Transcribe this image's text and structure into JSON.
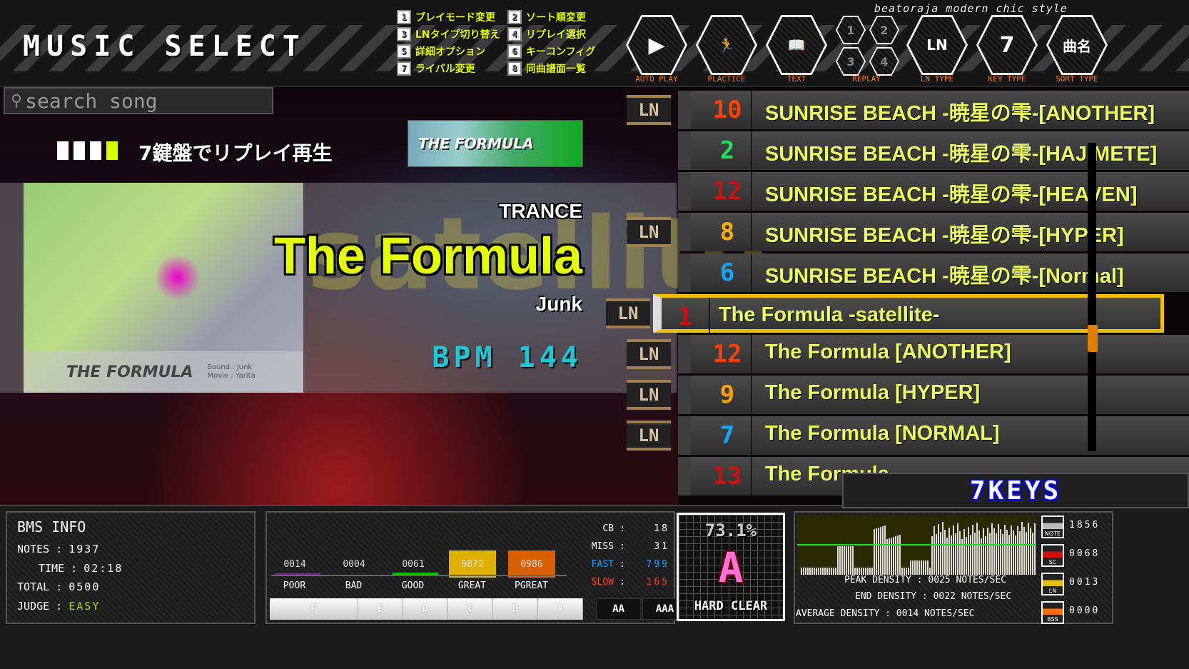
{
  "header": {
    "title": "MUSIC SELECT",
    "brand": "beatoraja modern chic style"
  },
  "legend": [
    {
      "key": "1",
      "label": "プレイモード変更"
    },
    {
      "key": "2",
      "label": "ソート順変更"
    },
    {
      "key": "3",
      "label": "LNタイプ切り替え"
    },
    {
      "key": "4",
      "label": "リプレイ選択"
    },
    {
      "key": "5",
      "label": "詳細オプション"
    },
    {
      "key": "6",
      "label": "キーコンフィグ"
    },
    {
      "key": "7",
      "label": "ライバル変更"
    },
    {
      "key": "8",
      "label": "同曲譜面一覧"
    }
  ],
  "toolbar": [
    {
      "id": "auto-play",
      "label": "AUTO PLAY",
      "glyph": "▶",
      "icon": "play-icon"
    },
    {
      "id": "practice",
      "label": "PLACTICE",
      "glyph": "🏃",
      "icon": "treadmill-runner-icon"
    },
    {
      "id": "text",
      "label": "TEXT",
      "glyph": "📖",
      "icon": "open-book-icon"
    },
    {
      "id": "replay",
      "label": "REPLAY",
      "slots": [
        "1",
        "2",
        "3",
        "4"
      ],
      "icon": "replay-slot-icon"
    },
    {
      "id": "ln-type",
      "label": "LN TYPE",
      "glyph": "LN",
      "icon": "ln-icon"
    },
    {
      "id": "key-type",
      "label": "KEY TYPE",
      "glyph": "7",
      "icon": "key-seven-icon"
    },
    {
      "id": "sort-type",
      "label": "SORT TYPE",
      "glyph": "曲名",
      "icon": "sort-title-icon"
    }
  ],
  "search": {
    "placeholder": "search song"
  },
  "replay_hint": "7鍵盤でリプレイ再生",
  "banner": {
    "logo": "THE FORMULA"
  },
  "song": {
    "genre": "TRANCE",
    "title": "The Formula",
    "subtitle": "satellite",
    "artist": "Junk",
    "bpm_label": "BPM",
    "bpm": "144",
    "stagefile": {
      "logo": "THE FORMULA",
      "credits": [
        "Sound : Junk",
        "Movie : Yarita"
      ]
    }
  },
  "ln_badge": "LN",
  "song_list": [
    {
      "level": "10",
      "color": "#ff4000",
      "title": "SUNRISE BEACH -暁星の雫-[ANOTHER]",
      "ln": true
    },
    {
      "level": "2",
      "color": "#20e060",
      "title": "SUNRISE BEACH -暁星の雫-[HAJIMETE]",
      "ln": false
    },
    {
      "level": "12",
      "color": "#d01010",
      "title": "SUNRISE BEACH -暁星の雫-[HEAVEN]",
      "ln": false
    },
    {
      "level": "8",
      "color": "#ffb000",
      "title": "SUNRISE BEACH -暁星の雫-[HYPER]",
      "ln": true
    },
    {
      "level": "6",
      "color": "#10a8ff",
      "title": "SUNRISE BEACH -暁星の雫-[Normal]",
      "ln": false
    },
    {
      "level": "1",
      "color": "#d01010",
      "title": "The Formula -satellite-",
      "ln": true,
      "selected": true
    },
    {
      "level": "12",
      "color": "#ff4000",
      "title": "The Formula [ANOTHER]",
      "ln": true
    },
    {
      "level": "9",
      "color": "#ffa000",
      "title": "The Formula [HYPER]",
      "ln": true
    },
    {
      "level": "7",
      "color": "#10a8ff",
      "title": "The Formula [NORMAL]",
      "ln": true
    },
    {
      "level": "13",
      "color": "#d01010",
      "title": "The Formula",
      "ln": false
    }
  ],
  "keys_label": "7KEYS",
  "bms_info": {
    "heading": "BMS INFO",
    "notes_label": "NOTES",
    "notes": "1937",
    "time_label": "TIME",
    "time": "02:18",
    "total_label": "TOTAL",
    "total": "0500",
    "judge_label": "JUDGE",
    "judge": "EASY",
    "judge_color": "#a8d000"
  },
  "judges": [
    {
      "label": "POOR",
      "value": "0014"
    },
    {
      "label": "BAD",
      "value": "0004"
    },
    {
      "label": "GOOD",
      "value": "0061"
    },
    {
      "label": "GREAT",
      "value": "0872",
      "color": "#e0b000"
    },
    {
      "label": "PGREAT",
      "value": "0986",
      "color": "#d86000"
    }
  ],
  "ranks": [
    "F",
    "E",
    "D",
    "C",
    "B",
    "A",
    "AA",
    "AAA"
  ],
  "score_stats": [
    {
      "label": "CB",
      "value": "18",
      "color": "#ffffff"
    },
    {
      "label": "MISS",
      "value": "31",
      "color": "#ffffff"
    },
    {
      "label": "FAST",
      "value": "799",
      "color": "#10a0ff"
    },
    {
      "label": "SLOW",
      "value": "165",
      "color": "#ff4010"
    }
  ],
  "grade": {
    "rate": "73.1%",
    "rank": "A",
    "clear": "HARD CLEAR",
    "rank_color": "#ff70d8"
  },
  "density": {
    "peak_label": "PEAK DENSITY",
    "peak": "0025",
    "end_label": "END DENSITY",
    "end": "0022",
    "avg_label": "AVERAGE DENSITY",
    "avg": "0014",
    "unit": "NOTES/SEC"
  },
  "note_types": [
    {
      "label": "NOTE",
      "value": "1856",
      "icon": "note-icon",
      "color": "#bbbbbb"
    },
    {
      "label": "SC",
      "value": "0068",
      "icon": "scratch-icon",
      "color": "#d01010"
    },
    {
      "label": "LN",
      "value": "0013",
      "icon": "long-note-icon",
      "color": "#e0c000"
    },
    {
      "label": "BSS",
      "value": "0000",
      "icon": "bss-icon",
      "color": "#ff7000"
    }
  ]
}
